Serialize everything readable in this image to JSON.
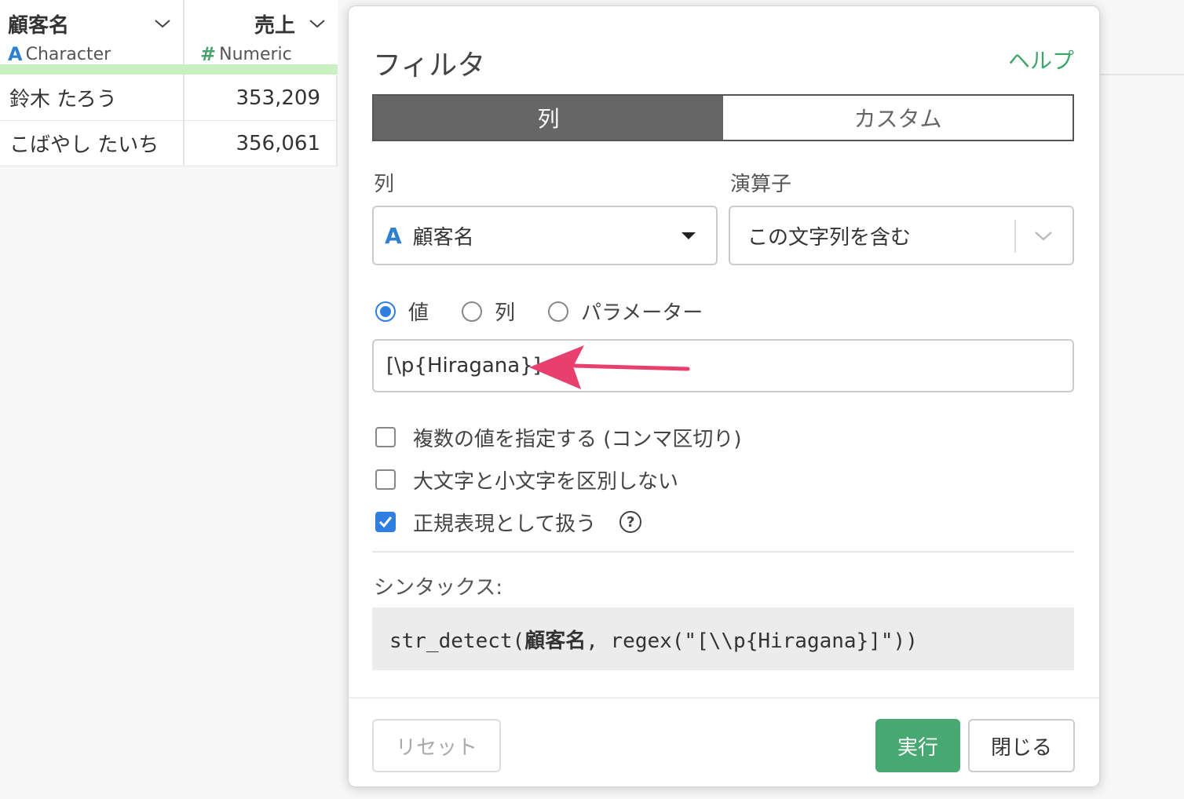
{
  "table": {
    "columns": [
      {
        "name": "顧客名",
        "type_icon": "A",
        "type": "Character"
      },
      {
        "name": "売上",
        "type_icon": "#",
        "type": "Numeric"
      }
    ],
    "rows": [
      [
        "鈴木 たろう",
        "353,209"
      ],
      [
        "こばやし たいち",
        "356,061"
      ]
    ]
  },
  "dialog": {
    "title": "フィルタ",
    "help": "ヘルプ",
    "tabs": {
      "column": "列",
      "custom": "カスタム"
    },
    "column_label": "列",
    "operator_label": "演算子",
    "column_select": {
      "icon": "A",
      "value": "顧客名"
    },
    "operator_select": {
      "value": "この文字列を含む"
    },
    "radios": {
      "value": "値",
      "column": "列",
      "parameter": "パラメーター",
      "selected": "value"
    },
    "value_input": "[\\p{Hiragana}]",
    "checkboxes": [
      {
        "label": "複数の値を指定する (コンマ区切り)",
        "checked": false
      },
      {
        "label": "大文字と小文字を区別しない",
        "checked": false
      },
      {
        "label": "正規表現として扱う",
        "checked": true
      }
    ],
    "syntax_label": "シンタックス:",
    "syntax": {
      "pre": "str_detect(",
      "bold": "顧客名",
      "post": ", regex(\"[\\\\p{Hiragana}]\"))"
    },
    "buttons": {
      "reset": "リセット",
      "run": "実行",
      "close": "閉じる"
    }
  },
  "colors": {
    "accent_blue": "#2f7fe0",
    "run_green": "#47a871",
    "help_green": "#3fa66a",
    "arrow_pink": "#e8406e"
  }
}
